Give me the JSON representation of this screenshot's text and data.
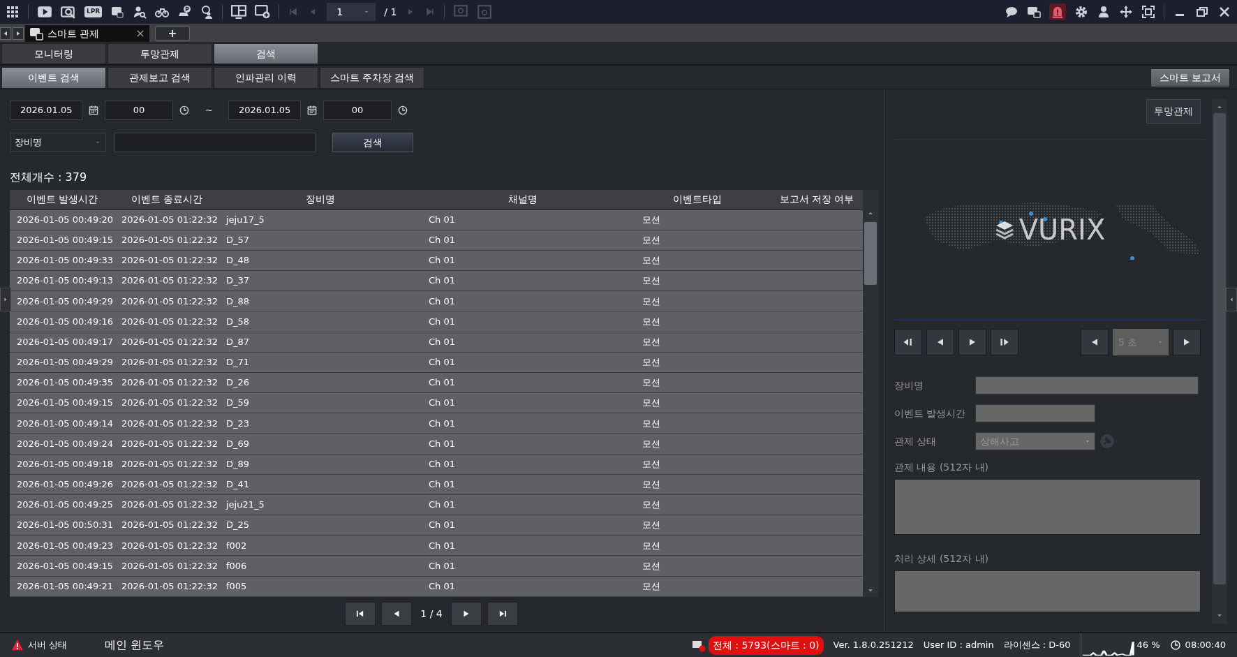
{
  "toolbar": {
    "lpr_label": "LPR",
    "page_value": "1",
    "page_total": "/ 1"
  },
  "window_tab": {
    "title": "스마트 관제"
  },
  "main_tabs": [
    {
      "label": "모니터링",
      "selected": false
    },
    {
      "label": "투망관제",
      "selected": false
    },
    {
      "label": "검색",
      "selected": true
    }
  ],
  "sub_tabs": [
    {
      "label": "이벤트 검색",
      "selected": true
    },
    {
      "label": "관제보고 검색",
      "selected": false
    },
    {
      "label": "인파관리 이력",
      "selected": false
    },
    {
      "label": "스마트 주차장 검색",
      "selected": false
    }
  ],
  "report_button": "스마트 보고서",
  "search": {
    "start_date": "2026.01.05",
    "start_hour": "00",
    "separator": "~",
    "end_date": "2026.01.05",
    "end_hour": "00",
    "filter": "장비명",
    "button": "검색"
  },
  "total": "전체개수 : 379",
  "table": {
    "columns": [
      "이벤트 발생시간",
      "이벤트 종료시간",
      "장비명",
      "채널명",
      "이벤트타입",
      "보고서 저장 여부"
    ],
    "rows": [
      [
        "2026-01-05 00:49:20",
        "2026-01-05 01:22:32",
        "jeju17_5",
        "Ch 01",
        "모션"
      ],
      [
        "2026-01-05 00:49:15",
        "2026-01-05 01:22:32",
        "D_57",
        "Ch 01",
        "모션"
      ],
      [
        "2026-01-05 00:49:33",
        "2026-01-05 01:22:32",
        "D_48",
        "Ch 01",
        "모션"
      ],
      [
        "2026-01-05 00:49:13",
        "2026-01-05 01:22:32",
        "D_37",
        "Ch 01",
        "모션"
      ],
      [
        "2026-01-05 00:49:29",
        "2026-01-05 01:22:32",
        "D_88",
        "Ch 01",
        "모션"
      ],
      [
        "2026-01-05 00:49:16",
        "2026-01-05 01:22:32",
        "D_58",
        "Ch 01",
        "모션"
      ],
      [
        "2026-01-05 00:49:17",
        "2026-01-05 01:22:32",
        "D_87",
        "Ch 01",
        "모션"
      ],
      [
        "2026-01-05 00:49:29",
        "2026-01-05 01:22:32",
        "D_71",
        "Ch 01",
        "모션"
      ],
      [
        "2026-01-05 00:49:35",
        "2026-01-05 01:22:32",
        "D_26",
        "Ch 01",
        "모션"
      ],
      [
        "2026-01-05 00:49:15",
        "2026-01-05 01:22:32",
        "D_59",
        "Ch 01",
        "모션"
      ],
      [
        "2026-01-05 00:49:14",
        "2026-01-05 01:22:32",
        "D_23",
        "Ch 01",
        "모션"
      ],
      [
        "2026-01-05 00:49:24",
        "2026-01-05 01:22:32",
        "D_69",
        "Ch 01",
        "모션"
      ],
      [
        "2026-01-05 00:49:18",
        "2026-01-05 01:22:32",
        "D_89",
        "Ch 01",
        "모션"
      ],
      [
        "2026-01-05 00:49:26",
        "2026-01-05 01:22:32",
        "D_41",
        "Ch 01",
        "모션"
      ],
      [
        "2026-01-05 00:49:25",
        "2026-01-05 01:22:32",
        "jeju21_5",
        "Ch 01",
        "모션"
      ],
      [
        "2026-01-05 00:50:31",
        "2026-01-05 01:22:32",
        "D_25",
        "Ch 01",
        "모션"
      ],
      [
        "2026-01-05 00:49:23",
        "2026-01-05 01:22:32",
        "f002",
        "Ch 01",
        "모션"
      ],
      [
        "2026-01-05 00:49:15",
        "2026-01-05 01:22:32",
        "f006",
        "Ch 01",
        "모션"
      ],
      [
        "2026-01-05 00:49:21",
        "2026-01-05 01:22:32",
        "f005",
        "Ch 01",
        "모션"
      ]
    ]
  },
  "pagination": "1 / 4",
  "detail": {
    "map_button": "투망관제",
    "logo": "VURIX",
    "interval": "5 초",
    "device_label": "장비명",
    "time_label": "이벤트 발생시간",
    "status_label": "관제 상태",
    "status_value": "상해사고",
    "content_label": "관제 내용 (512자 내)",
    "process_label": "처리 상세 (512자 내)"
  },
  "status_bar": {
    "server": "서버 상태",
    "window": "메인 윈도우",
    "total": "전체 : 5793(스마트 : 0)",
    "version": "Ver. 1.8.0.251212",
    "user": "User ID : admin",
    "license": "라이센스 : D-60",
    "cpu": "46 %",
    "time": "08:00:40"
  }
}
